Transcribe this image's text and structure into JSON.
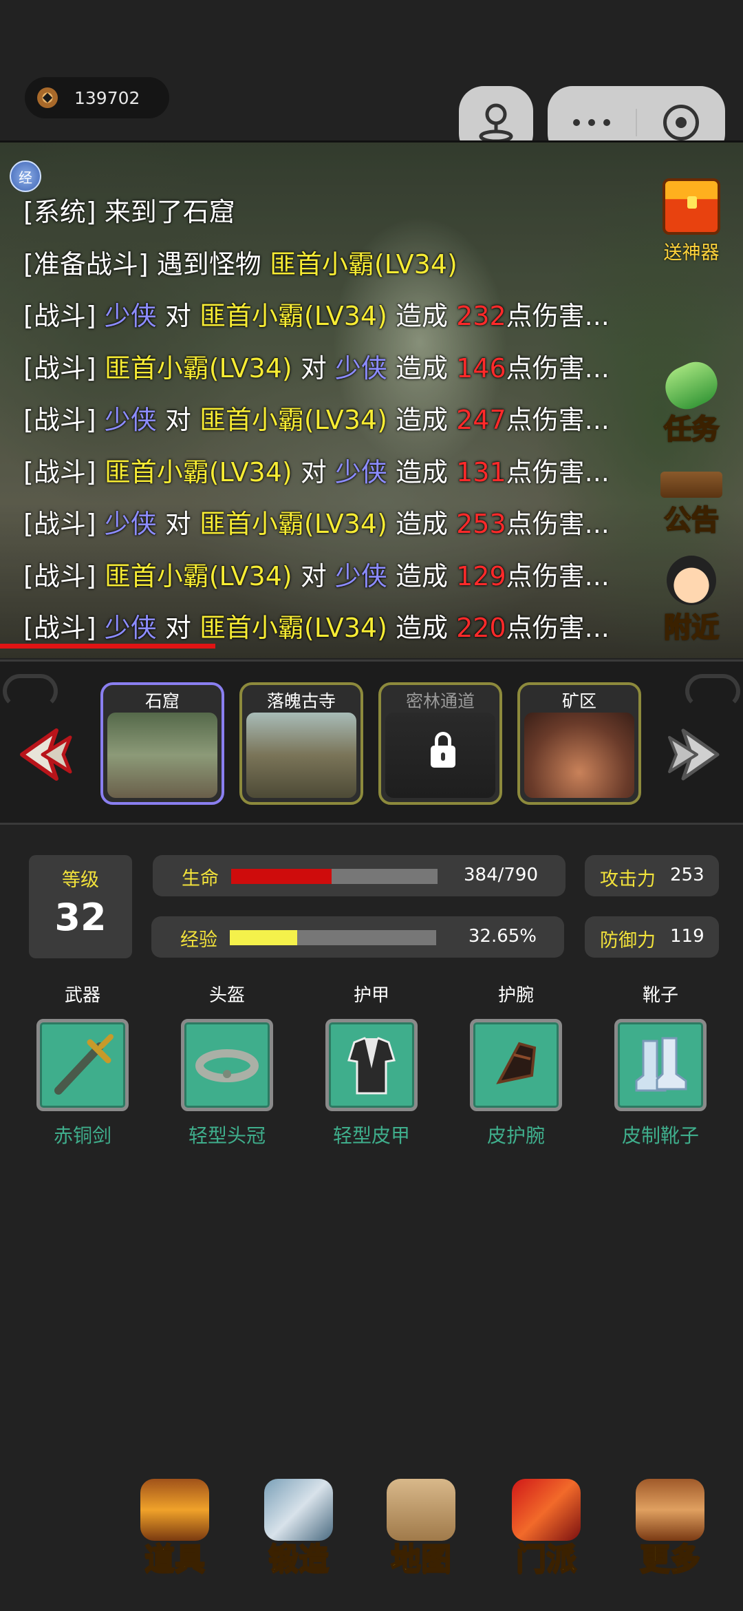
{
  "currency": {
    "icon": "coin-icon",
    "value": "139702"
  },
  "miniprogram": {
    "account_icon": "joystick-icon",
    "more_icon": "more-dots-icon",
    "close_icon": "target-icon"
  },
  "scene": {
    "badge": "经",
    "log": [
      [
        {
          "t": "[系统] ",
          "c": "white"
        },
        {
          "t": "来到了石窟",
          "c": "white"
        }
      ],
      [
        {
          "t": "[准备战斗] ",
          "c": "white"
        },
        {
          "t": "遇到怪物 ",
          "c": "white"
        },
        {
          "t": "匪首小霸(LV34)",
          "c": "yellow"
        }
      ],
      [
        {
          "t": "[战斗] ",
          "c": "white"
        },
        {
          "t": "少侠",
          "c": "blue"
        },
        {
          "t": " 对 ",
          "c": "white"
        },
        {
          "t": "匪首小霸(LV34)",
          "c": "yellow"
        },
        {
          "t": " 造成 ",
          "c": "white"
        },
        {
          "t": "232",
          "c": "red"
        },
        {
          "t": "点伤害...",
          "c": "white"
        }
      ],
      [
        {
          "t": "[战斗] ",
          "c": "white"
        },
        {
          "t": "匪首小霸(LV34)",
          "c": "yellow"
        },
        {
          "t": " 对 ",
          "c": "white"
        },
        {
          "t": "少侠",
          "c": "blue"
        },
        {
          "t": " 造成 ",
          "c": "white"
        },
        {
          "t": "146",
          "c": "red"
        },
        {
          "t": "点伤害...",
          "c": "white"
        }
      ],
      [
        {
          "t": "[战斗] ",
          "c": "white"
        },
        {
          "t": "少侠",
          "c": "blue"
        },
        {
          "t": " 对 ",
          "c": "white"
        },
        {
          "t": "匪首小霸(LV34)",
          "c": "yellow"
        },
        {
          "t": " 造成 ",
          "c": "white"
        },
        {
          "t": "247",
          "c": "red"
        },
        {
          "t": "点伤害...",
          "c": "white"
        }
      ],
      [
        {
          "t": "[战斗] ",
          "c": "white"
        },
        {
          "t": "匪首小霸(LV34)",
          "c": "yellow"
        },
        {
          "t": " 对 ",
          "c": "white"
        },
        {
          "t": "少侠",
          "c": "blue"
        },
        {
          "t": " 造成 ",
          "c": "white"
        },
        {
          "t": "131",
          "c": "red"
        },
        {
          "t": "点伤害...",
          "c": "white"
        }
      ],
      [
        {
          "t": "[战斗] ",
          "c": "white"
        },
        {
          "t": "少侠",
          "c": "blue"
        },
        {
          "t": " 对 ",
          "c": "white"
        },
        {
          "t": "匪首小霸(LV34)",
          "c": "yellow"
        },
        {
          "t": " 造成 ",
          "c": "white"
        },
        {
          "t": "253",
          "c": "red"
        },
        {
          "t": "点伤害...",
          "c": "white"
        }
      ],
      [
        {
          "t": "[战斗] ",
          "c": "white"
        },
        {
          "t": "匪首小霸(LV34)",
          "c": "yellow"
        },
        {
          "t": " 对 ",
          "c": "white"
        },
        {
          "t": "少侠",
          "c": "blue"
        },
        {
          "t": " 造成 ",
          "c": "white"
        },
        {
          "t": "129",
          "c": "red"
        },
        {
          "t": "点伤害...",
          "c": "white"
        }
      ],
      [
        {
          "t": "[战斗] ",
          "c": "white"
        },
        {
          "t": "少侠",
          "c": "blue"
        },
        {
          "t": " 对 ",
          "c": "white"
        },
        {
          "t": "匪首小霸(LV34)",
          "c": "yellow"
        },
        {
          "t": " 造成 ",
          "c": "white"
        },
        {
          "t": "220",
          "c": "red"
        },
        {
          "t": "点伤害...",
          "c": "white"
        }
      ]
    ],
    "battle_progress": 0.29,
    "side_buttons": {
      "gift": {
        "label": "送神器",
        "icon": "treasure-chest-icon"
      },
      "quest": {
        "label": "任务",
        "icon": "scroll-icon"
      },
      "notice": {
        "label": "公告",
        "icon": "notice-board-icon"
      },
      "nearby": {
        "label": "附近",
        "icon": "npc-avatar-icon"
      }
    }
  },
  "maps": [
    {
      "name": "石窟",
      "active": true,
      "locked": false
    },
    {
      "name": "落魄古寺",
      "active": false,
      "locked": false
    },
    {
      "name": "密林通道",
      "active": false,
      "locked": true
    },
    {
      "name": "矿区",
      "active": false,
      "locked": false
    }
  ],
  "stats": {
    "level_label": "等级",
    "level": "32",
    "hp_label": "生命",
    "hp_text": "384/790",
    "hp_ratio": 0.486,
    "exp_label": "经验",
    "exp_text": "32.65%",
    "exp_ratio": 0.3265,
    "attack_label": "攻击力",
    "attack": "253",
    "defense_label": "防御力",
    "defense": "119"
  },
  "equipment": [
    {
      "slot": "武器",
      "name": "赤铜剑",
      "icon": "sword-icon"
    },
    {
      "slot": "头盔",
      "name": "轻型头冠",
      "icon": "headband-icon"
    },
    {
      "slot": "护甲",
      "name": "轻型皮甲",
      "icon": "armor-icon"
    },
    {
      "slot": "护腕",
      "name": "皮护腕",
      "icon": "bracer-icon"
    },
    {
      "slot": "靴子",
      "name": "皮制靴子",
      "icon": "boots-icon"
    }
  ],
  "nav": [
    {
      "label": "道具",
      "icon": "item-bag-icon"
    },
    {
      "label": "锻造",
      "icon": "crossed-swords-icon"
    },
    {
      "label": "地图",
      "icon": "map-scroll-icon"
    },
    {
      "label": "门派",
      "icon": "sect-flag-icon"
    },
    {
      "label": "更多",
      "icon": "more-board-icon"
    }
  ],
  "colors": {
    "yellow": "#f7ec34",
    "blue": "#8c8cff",
    "red": "#ff2a2a",
    "equip_green": "#3fae8c"
  }
}
